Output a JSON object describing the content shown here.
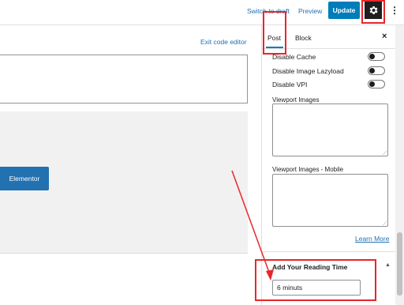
{
  "header": {
    "switch_to_draft": "Switch to draft",
    "preview": "Preview",
    "update": "Update",
    "settings_icon": "gear-icon",
    "more_icon": "kebab-icon"
  },
  "editor": {
    "exit_code_editor": "Exit code editor",
    "elementor_button": "Elementor"
  },
  "sidebar": {
    "tabs": [
      {
        "label": "Post"
      },
      {
        "label": "Block"
      }
    ],
    "close_icon": "×",
    "options": [
      {
        "label": "Disable Cache",
        "enabled": false
      },
      {
        "label": "Disable Image Lazyload",
        "enabled": false
      },
      {
        "label": "Disable VPI",
        "enabled": false
      }
    ],
    "viewport_images_label": "Viewport Images",
    "viewport_images_mobile_label": "Viewport Images - Mobile",
    "learn_more": "Learn More",
    "reading_time_title": "Add Your Reading Time",
    "reading_time_value": "6 minuts"
  },
  "colors": {
    "accent": "#007cba",
    "annotation_red": "#e8262c"
  }
}
